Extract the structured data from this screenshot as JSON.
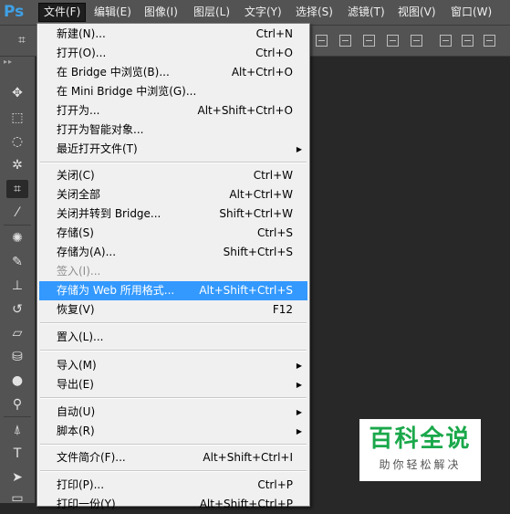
{
  "app": {
    "logo": "Ps"
  },
  "menubar": {
    "items": [
      {
        "label": "文件(F)",
        "active": true
      },
      {
        "label": "编辑(E)"
      },
      {
        "label": "图像(I)"
      },
      {
        "label": "图层(L)"
      },
      {
        "label": "文字(Y)"
      },
      {
        "label": "选择(S)"
      },
      {
        "label": "滤镜(T)"
      },
      {
        "label": "视图(V)"
      },
      {
        "label": "窗口(W)"
      }
    ]
  },
  "file_menu": {
    "items": [
      {
        "label": "新建(N)...",
        "shortcut": "Ctrl+N"
      },
      {
        "label": "打开(O)...",
        "shortcut": "Ctrl+O"
      },
      {
        "label": "在 Bridge 中浏览(B)...",
        "shortcut": "Alt+Ctrl+O"
      },
      {
        "label": "在 Mini Bridge 中浏览(G)...",
        "shortcut": ""
      },
      {
        "label": "打开为...",
        "shortcut": "Alt+Shift+Ctrl+O"
      },
      {
        "label": "打开为智能对象...",
        "shortcut": ""
      },
      {
        "label": "最近打开文件(T)",
        "shortcut": "",
        "submenu": true
      },
      {
        "label": "关闭(C)",
        "shortcut": "Ctrl+W"
      },
      {
        "label": "关闭全部",
        "shortcut": "Alt+Ctrl+W"
      },
      {
        "label": "关闭并转到 Bridge...",
        "shortcut": "Shift+Ctrl+W"
      },
      {
        "label": "存储(S)",
        "shortcut": "Ctrl+S"
      },
      {
        "label": "存储为(A)...",
        "shortcut": "Shift+Ctrl+S"
      },
      {
        "label": "签入(I)...",
        "shortcut": "",
        "disabled": true
      },
      {
        "label": "存储为 Web 所用格式...",
        "shortcut": "Alt+Shift+Ctrl+S",
        "highlighted": true
      },
      {
        "label": "恢复(V)",
        "shortcut": "F12"
      },
      {
        "label": "置入(L)...",
        "shortcut": ""
      },
      {
        "label": "导入(M)",
        "shortcut": "",
        "submenu": true
      },
      {
        "label": "导出(E)",
        "shortcut": "",
        "submenu": true
      },
      {
        "label": "自动(U)",
        "shortcut": "",
        "submenu": true
      },
      {
        "label": "脚本(R)",
        "shortcut": "",
        "submenu": true
      },
      {
        "label": "文件简介(F)...",
        "shortcut": "Alt+Shift+Ctrl+I"
      },
      {
        "label": "打印(P)...",
        "shortcut": "Ctrl+P"
      },
      {
        "label": "打印一份(Y)",
        "shortcut": "Alt+Shift+Ctrl+P"
      }
    ],
    "submenu_arrow": "▶"
  },
  "toolbox": {
    "grip": "▸▸",
    "tools": [
      {
        "name": "move-tool-icon",
        "glyph": "✥"
      },
      {
        "name": "marquee-tool-icon",
        "glyph": "⬚"
      },
      {
        "name": "lasso-tool-icon",
        "glyph": "◌"
      },
      {
        "name": "magic-wand-tool-icon",
        "glyph": "✲"
      },
      {
        "name": "crop-tool-icon",
        "glyph": "⌗",
        "selected": true
      },
      {
        "name": "eyedropper-tool-icon",
        "glyph": "⁄"
      },
      {
        "name": "healing-brush-tool-icon",
        "glyph": "✺"
      },
      {
        "name": "brush-tool-icon",
        "glyph": "✎"
      },
      {
        "name": "clone-stamp-tool-icon",
        "glyph": "⊥"
      },
      {
        "name": "history-brush-tool-icon",
        "glyph": "↺"
      },
      {
        "name": "eraser-tool-icon",
        "glyph": "▱"
      },
      {
        "name": "paint-bucket-tool-icon",
        "glyph": "⛁"
      },
      {
        "name": "blur-tool-icon",
        "glyph": "●"
      },
      {
        "name": "dodge-tool-icon",
        "glyph": "⚲"
      },
      {
        "name": "pen-tool-icon",
        "glyph": "⍋"
      },
      {
        "name": "type-tool-icon",
        "glyph": "T"
      },
      {
        "name": "path-selection-tool-icon",
        "glyph": "➤"
      },
      {
        "name": "shape-tool-icon",
        "glyph": "▭"
      }
    ]
  },
  "watermark": {
    "title": "百科全说",
    "subtitle": "助你轻松解决"
  }
}
